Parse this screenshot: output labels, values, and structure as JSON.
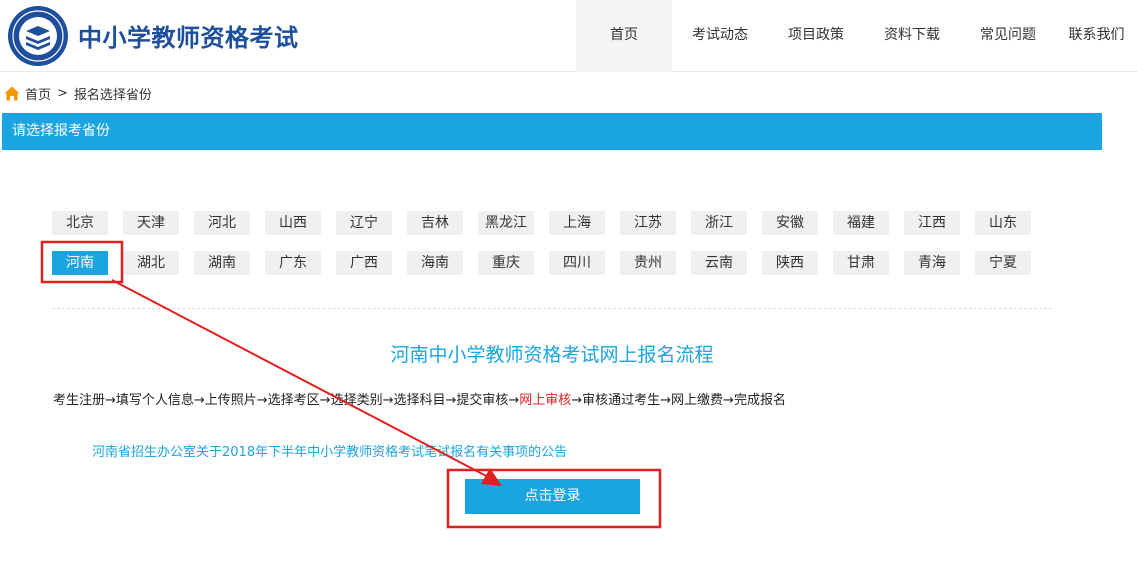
{
  "header": {
    "site_title": "中小学教师资格考试",
    "nav": [
      {
        "label": "首页",
        "active": true
      },
      {
        "label": "考试动态",
        "active": false
      },
      {
        "label": "项目政策",
        "active": false
      },
      {
        "label": "资料下载",
        "active": false
      },
      {
        "label": "常见问题",
        "active": false
      },
      {
        "label": "联系我们",
        "active": false
      }
    ]
  },
  "breadcrumb": {
    "home": "首页",
    "separator": ">",
    "current": "报名选择省份"
  },
  "section": {
    "title": "请选择报考省份"
  },
  "provinces": {
    "row1": [
      "北京",
      "天津",
      "河北",
      "山西",
      "辽宁",
      "吉林",
      "黑龙江",
      "上海",
      "江苏",
      "浙江",
      "安徽",
      "福建",
      "江西",
      "山东"
    ],
    "row2": [
      "河南",
      "湖北",
      "湖南",
      "广东",
      "广西",
      "海南",
      "重庆",
      "四川",
      "贵州",
      "云南",
      "陕西",
      "甘肃",
      "青海",
      "宁夏"
    ],
    "selected": "河南"
  },
  "flow": {
    "title": "河南中小学教师资格考试网上报名流程",
    "steps_before": "考生注册→填写个人信息→上传照片→选择考区→选择类别→选择科目→提交审核→",
    "steps_highlight": "网上审核",
    "steps_after": "→审核通过考生→网上缴费→完成报名"
  },
  "notice": {
    "link_text": "河南省招生办公室关于2018年下半年中小学教师资格考试笔试报名有关事项的公告"
  },
  "login": {
    "button_label": "点击登录"
  },
  "colors": {
    "accent": "#1aa5e0",
    "brand": "#1e4f9c",
    "highlight": "#e02020",
    "annotation": "#e02020"
  }
}
